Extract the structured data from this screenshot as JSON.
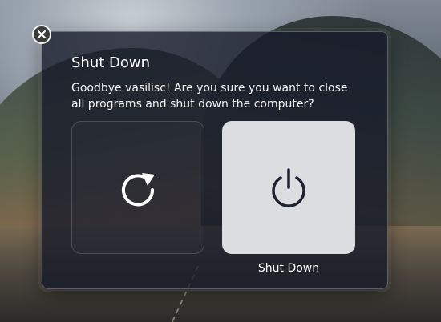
{
  "dialog": {
    "title": "Shut Down",
    "message": "Goodbye vasilisc! Are you sure you want to close all programs and shut down the computer?",
    "actions": [
      {
        "name": "restart",
        "icon": "restart-icon",
        "label": ""
      },
      {
        "name": "shutdown",
        "icon": "power-icon",
        "label": "Shut Down",
        "selected": true
      }
    ]
  },
  "colors": {
    "dialog_bg": "#141828",
    "selected_tile": "#dcdde1",
    "text": "#ffffff"
  }
}
